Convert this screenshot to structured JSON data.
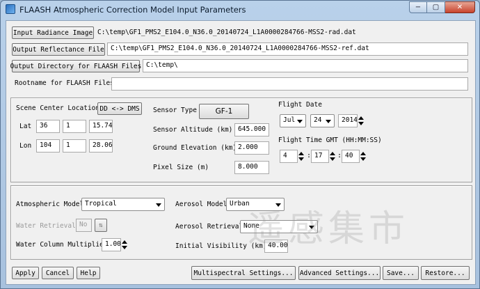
{
  "window": {
    "title": "FLAASH Atmospheric Correction Model Input Parameters",
    "min_glyph": "−",
    "max_glyph": "▢",
    "close_glyph": "✕"
  },
  "files": {
    "input_radiance_label": "Input Radiance Image",
    "input_radiance_value": "C:\\temp\\GF1_PMS2_E104.0_N36.0_20140724_L1A0000284766-MSS2-rad.dat",
    "output_reflectance_label": "Output Reflectance File",
    "output_reflectance_value": "C:\\temp\\GF1_PMS2_E104.0_N36.0_20140724_L1A0000284766-MSS2-ref.dat",
    "output_dir_label": "Output Directory for FLAASH Files",
    "output_dir_value": "C:\\temp\\",
    "rootname_label": "Rootname for FLAASH Files",
    "rootname_value": ""
  },
  "scene": {
    "center_label": "Scene Center Location",
    "dms_button": "DD <-> DMS",
    "lat_label": "Lat",
    "lat_deg": "36",
    "lat_min": "1",
    "lat_sec": "15.74",
    "lon_label": "Lon",
    "lon_deg": "104",
    "lon_min": "1",
    "lon_sec": "28.06",
    "sensor_type_label": "Sensor Type",
    "sensor_type_value": "GF-1",
    "sensor_altitude_label": "Sensor Altitude (km)",
    "sensor_altitude_value": "645.000",
    "ground_elevation_label": "Ground Elevation (km)",
    "ground_elevation_value": "2.000",
    "pixel_size_label": "Pixel Size (m)",
    "pixel_size_value": "8.000",
    "flight_date_label": "Flight Date",
    "month": "Jul",
    "day": "24",
    "year": "2014",
    "flight_time_label": "Flight Time GMT (HH:MM:SS)",
    "hh": "4",
    "mm": "17",
    "ss": "40",
    "colon": ":"
  },
  "model": {
    "atmospheric_model_label": "Atmospheric Model",
    "atmospheric_model_value": "Tropical",
    "water_retrieval_label": "Water Retrieval",
    "water_retrieval_value": "No",
    "water_column_label": "Water Column Multiplier",
    "water_column_value": "1.00",
    "aerosol_model_label": "Aerosol Model",
    "aerosol_model_value": "Urban",
    "aerosol_retrieval_label": "Aerosol Retrieval",
    "aerosol_retrieval_value": "None",
    "initial_visibility_label": "Initial Visibility (km)",
    "initial_visibility_value": "40.00"
  },
  "footer": {
    "apply": "Apply",
    "cancel": "Cancel",
    "help": "Help",
    "multispectral": "Multispectral Settings...",
    "advanced": "Advanced Settings...",
    "save": "Save...",
    "restore": "Restore..."
  },
  "watermark": "遥感集市"
}
